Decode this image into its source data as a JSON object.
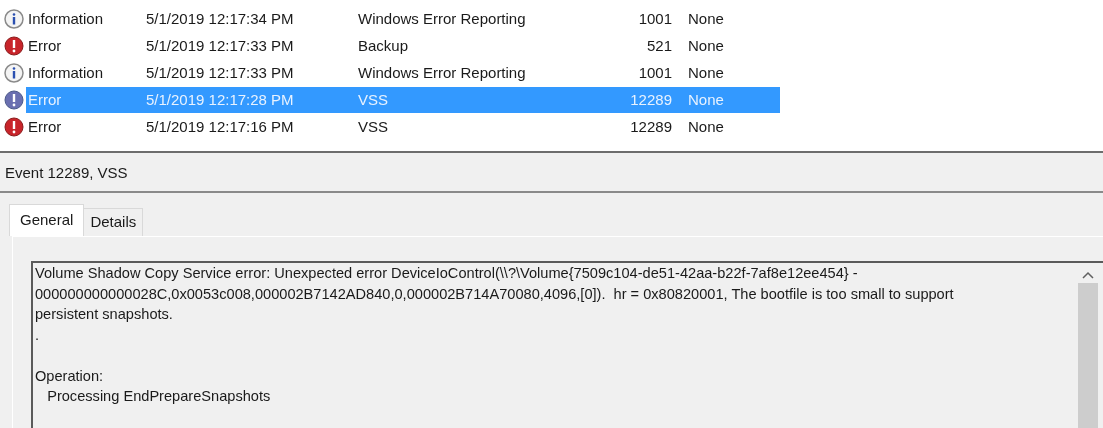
{
  "events": [
    {
      "kind": "information",
      "level": "Information",
      "date": "5/1/2019 12:17:34 PM",
      "source": "Windows Error Reporting",
      "event_id": "1001",
      "task": "None",
      "selected": false
    },
    {
      "kind": "error",
      "level": "Error",
      "date": "5/1/2019 12:17:33 PM",
      "source": "Backup",
      "event_id": "521",
      "task": "None",
      "selected": false
    },
    {
      "kind": "information",
      "level": "Information",
      "date": "5/1/2019 12:17:33 PM",
      "source": "Windows Error Reporting",
      "event_id": "1001",
      "task": "None",
      "selected": false
    },
    {
      "kind": "error",
      "level": "Error",
      "date": "5/1/2019 12:17:28 PM",
      "source": "VSS",
      "event_id": "12289",
      "task": "None",
      "selected": true
    },
    {
      "kind": "error",
      "level": "Error",
      "date": "5/1/2019 12:17:16 PM",
      "source": "VSS",
      "event_id": "12289",
      "task": "None",
      "selected": false
    }
  ],
  "detail": {
    "title": "Event 12289, VSS",
    "tabs": [
      {
        "label": "General",
        "selected": true
      },
      {
        "label": "Details",
        "selected": false
      }
    ],
    "message": "Volume Shadow Copy Service error: Unexpected error DeviceIoControl(\\\\?\\Volume{7509c104-de51-42aa-b22f-7af8e12ee454} - \n000000000000028C,0x0053c008,000002B7142AD840,0,000002B714A70080,4096,[0]).  hr = 0x80820001, The bootfile is too small to support \npersistent snapshots.\n.\n\nOperation:\n   Processing EndPrepareSnapshots"
  }
}
